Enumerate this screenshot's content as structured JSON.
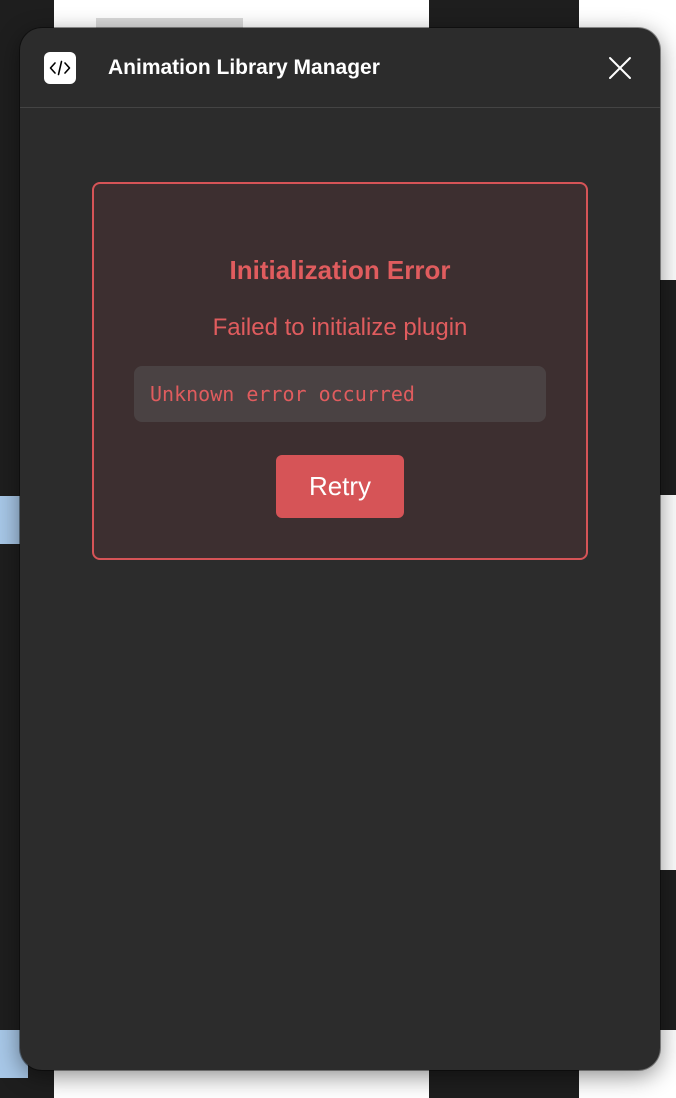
{
  "window": {
    "title": "Animation Library Manager",
    "app_icon": "code-icon",
    "close_icon": "close-icon"
  },
  "error": {
    "title": "Initialization Error",
    "message": "Failed to initialize plugin",
    "detail": "Unknown error occurred",
    "retry_label": "Retry"
  },
  "colors": {
    "dialog_bg": "#2c2c2c",
    "error_accent": "#d65457",
    "error_text": "#e05c5e",
    "card_bg": "#3d2f30",
    "detail_bg": "#4a4243"
  }
}
